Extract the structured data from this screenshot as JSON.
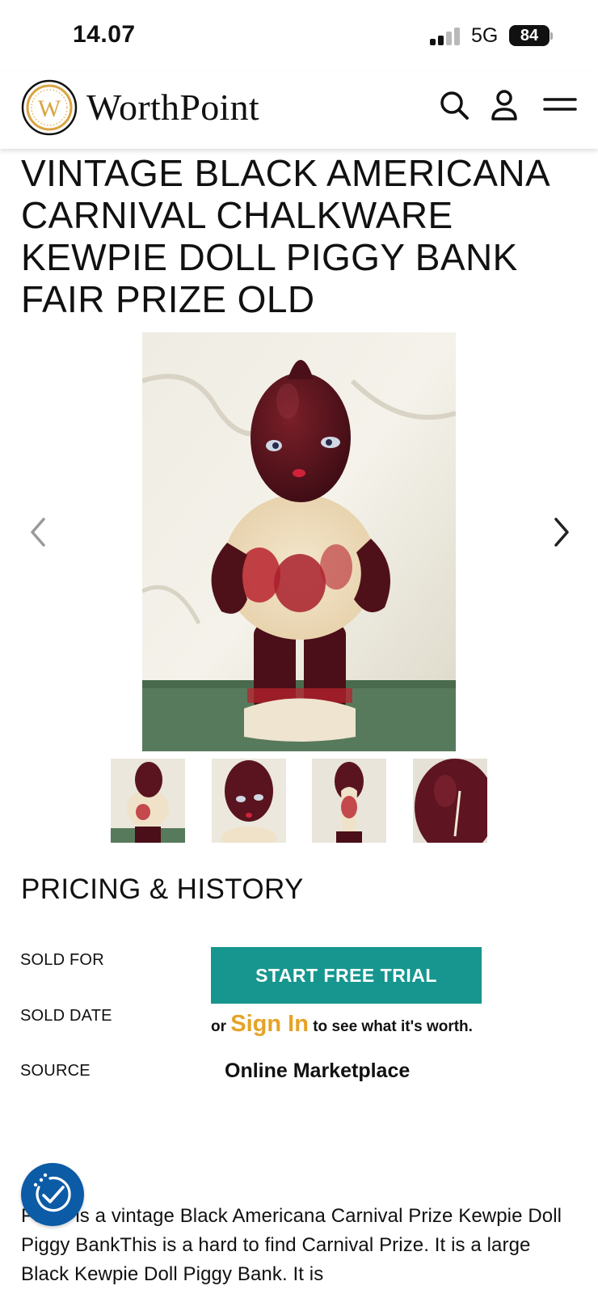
{
  "status_bar": {
    "time": "14.07",
    "network": "5G",
    "battery": "84"
  },
  "header": {
    "logo_letter": "W",
    "logo_text": "WorthPoint",
    "icons": [
      "search-icon",
      "account-icon",
      "menu-icon"
    ]
  },
  "product": {
    "title": "VINTAGE BLACK AMERICANA CARNIVAL CHALKWARE KEWPIE DOLL PIGGY BANK FAIR PRIZE OLD"
  },
  "gallery": {
    "thumbnail_count": 4,
    "icons": [
      "chevron-left-icon",
      "chevron-right-icon"
    ]
  },
  "pricing": {
    "section_title": "PRICING & HISTORY",
    "sold_for_label": "SOLD FOR",
    "sold_date_label": "SOLD DATE",
    "source_label": "SOURCE",
    "trial_button": "START FREE TRIAL",
    "signin_prefix": "or",
    "signin_link": "Sign In",
    "signin_suffix": "to see what it's worth.",
    "source_value": "Online Marketplace"
  },
  "description": {
    "text_visible": "ale is a vintage Black Americana Carnival Prize Kewpie Doll Piggy BankThis is a hard to find Carnival Prize. It is a large Black Kewpie Doll Piggy Bank. It is",
    "text_partial_prefix": "Fo"
  },
  "colors": {
    "accent_teal": "#16968f",
    "signin_gold": "#e5a326",
    "badge_blue": "#0b5ba6",
    "logo_gold": "#d9a441"
  }
}
